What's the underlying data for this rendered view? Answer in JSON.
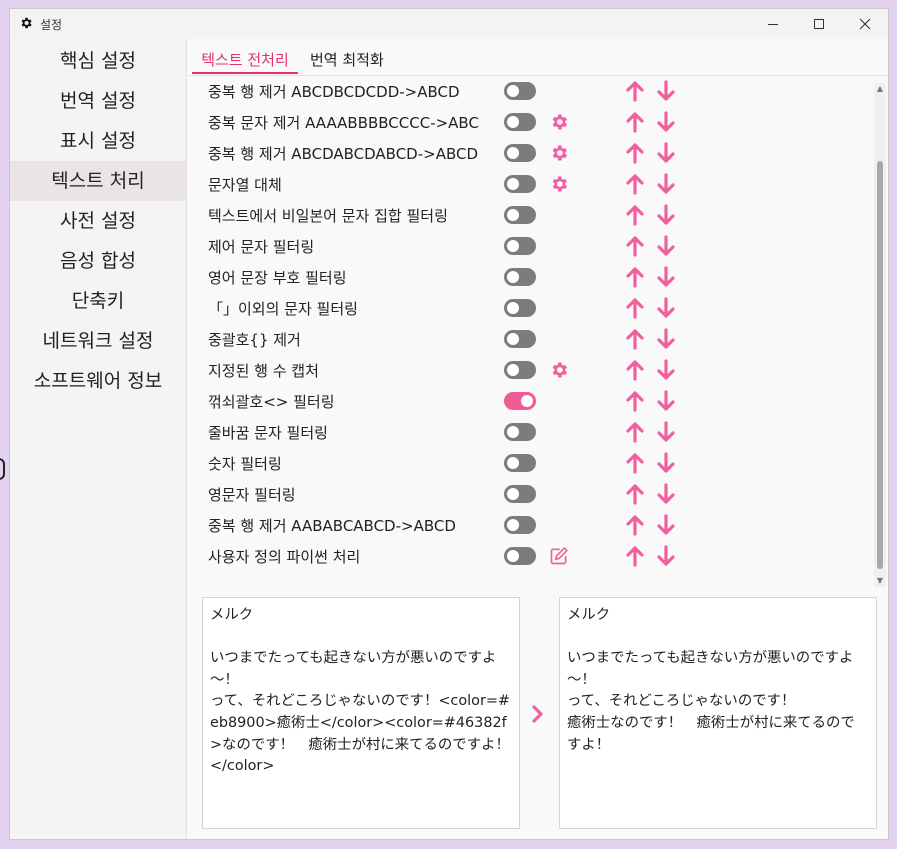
{
  "window": {
    "title": "설정"
  },
  "colors": {
    "accent": "#e5316f",
    "toggle_on": "#ed5c96",
    "icon_pink": "#f0609e"
  },
  "sidebar": {
    "items": [
      {
        "label": "핵심 설정"
      },
      {
        "label": "번역 설정"
      },
      {
        "label": "표시 설정"
      },
      {
        "label": "텍스트 처리",
        "active": true
      },
      {
        "label": "사전 설정"
      },
      {
        "label": "음성 합성"
      },
      {
        "label": "단축키"
      },
      {
        "label": "네트워크 설정"
      },
      {
        "label": "소프트웨어 정보"
      }
    ]
  },
  "tabs": [
    {
      "label": "텍스트 전처리",
      "active": true
    },
    {
      "label": "번역 최적화"
    }
  ],
  "rows": [
    {
      "label": "중복 행 제거 ABCDBCDCDD->ABCD",
      "on": false,
      "extra": "none"
    },
    {
      "label": "중복 문자 제거 AAAABBBBCCCC->ABC",
      "on": false,
      "extra": "gear-icon"
    },
    {
      "label": "중복 행 제거 ABCDABCDABCD->ABCD",
      "on": false,
      "extra": "gear-icon"
    },
    {
      "label": "문자열 대체",
      "on": false,
      "extra": "gear-icon"
    },
    {
      "label": "텍스트에서 비일본어 문자 집합 필터링",
      "on": false,
      "extra": "none"
    },
    {
      "label": "제어 문자 필터링",
      "on": false,
      "extra": "none"
    },
    {
      "label": "영어 문장 부호 필터링",
      "on": false,
      "extra": "none"
    },
    {
      "label": "「」이외의 문자 필터링",
      "on": false,
      "extra": "none"
    },
    {
      "label": "중괄호{} 제거",
      "on": false,
      "extra": "none"
    },
    {
      "label": "지정된 행 수 캡처",
      "on": false,
      "extra": "gear-icon"
    },
    {
      "label": "꺾쇠괄호<> 필터링",
      "on": true,
      "extra": "none"
    },
    {
      "label": "줄바꿈 문자 필터링",
      "on": false,
      "extra": "none"
    },
    {
      "label": "숫자 필터링",
      "on": false,
      "extra": "none"
    },
    {
      "label": "영문자 필터링",
      "on": false,
      "extra": "none"
    },
    {
      "label": "중복 행 제거 AABABCABCD->ABCD",
      "on": false,
      "extra": "none"
    },
    {
      "label": "사용자 정의 파이썬 처리",
      "on": false,
      "extra": "edit-icon"
    }
  ],
  "input_text": "メルク\n\nいつまでたっても起きない方が悪いのですよ～！\nって、それどころじゃないのです！<color=#eb8900>癒術士</color><color=#46382f>なのです！　癒術士が村に来てるのですよ！</color>",
  "output_text": "メルク\n\nいつまでたっても起きない方が悪いのですよ～！\nって、それどころじゃないのです！\n癒術士なのです！　癒術士が村に来てるのですよ！"
}
